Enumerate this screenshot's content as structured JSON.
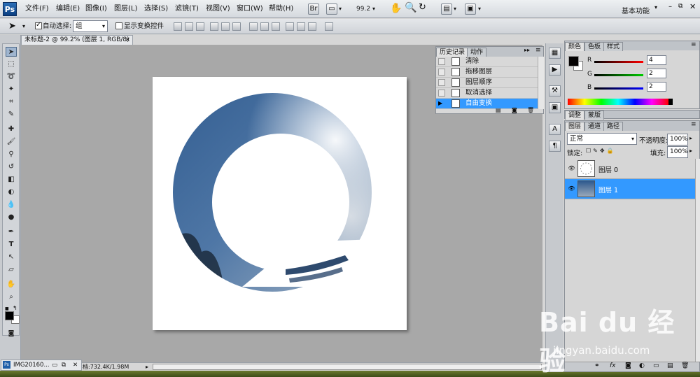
{
  "app": {
    "logo": "Ps"
  },
  "menu": [
    "文件(F)",
    "编辑(E)",
    "图像(I)",
    "图层(L)",
    "选择(S)",
    "滤镜(T)",
    "视图(V)",
    "窗口(W)",
    "帮助(H)"
  ],
  "toolbar": {
    "zoom_value": "99.2",
    "workspace": "基本功能"
  },
  "options": {
    "auto_select_label": "自动选择:",
    "auto_select_value": "组",
    "show_transform_label": "显示变换控件"
  },
  "document": {
    "tab_title": "未标题-2 @ 99.2% (图层 1, RGB/8) *",
    "status_text": "档:732.4K/1.98M",
    "minimized_title": "IMG20160..."
  },
  "history": {
    "tabs": [
      "历史记录",
      "动作"
    ],
    "items": [
      {
        "label": "清除",
        "selected": false
      },
      {
        "label": "拖移图层",
        "selected": false
      },
      {
        "label": "图层顺序",
        "selected": false
      },
      {
        "label": "取消选择",
        "selected": false
      },
      {
        "label": "自由变换",
        "selected": true
      }
    ]
  },
  "color_panel": {
    "tabs": [
      "颜色",
      "色板",
      "样式"
    ],
    "r_label": "R",
    "g_label": "G",
    "b_label": "B",
    "r_value": "4",
    "g_value": "2",
    "b_value": "2"
  },
  "adjust_panel": {
    "tabs": [
      "调整",
      "蒙版"
    ]
  },
  "layers_panel": {
    "tabs": [
      "图层",
      "通道",
      "路径"
    ],
    "blend_mode": "正常",
    "opacity_label": "不透明度:",
    "opacity_value": "100%",
    "lock_label": "锁定:",
    "fill_label": "填充:",
    "fill_value": "100%",
    "layers": [
      {
        "name": "图层 0",
        "selected": false
      },
      {
        "name": "图层 1",
        "selected": true
      }
    ]
  },
  "watermark": {
    "brand": "Bai du 经验",
    "url": "jingyan.baidu.com"
  },
  "colors": {
    "selection": "#3399ff",
    "canvas_bg": "#a8a8a8"
  }
}
